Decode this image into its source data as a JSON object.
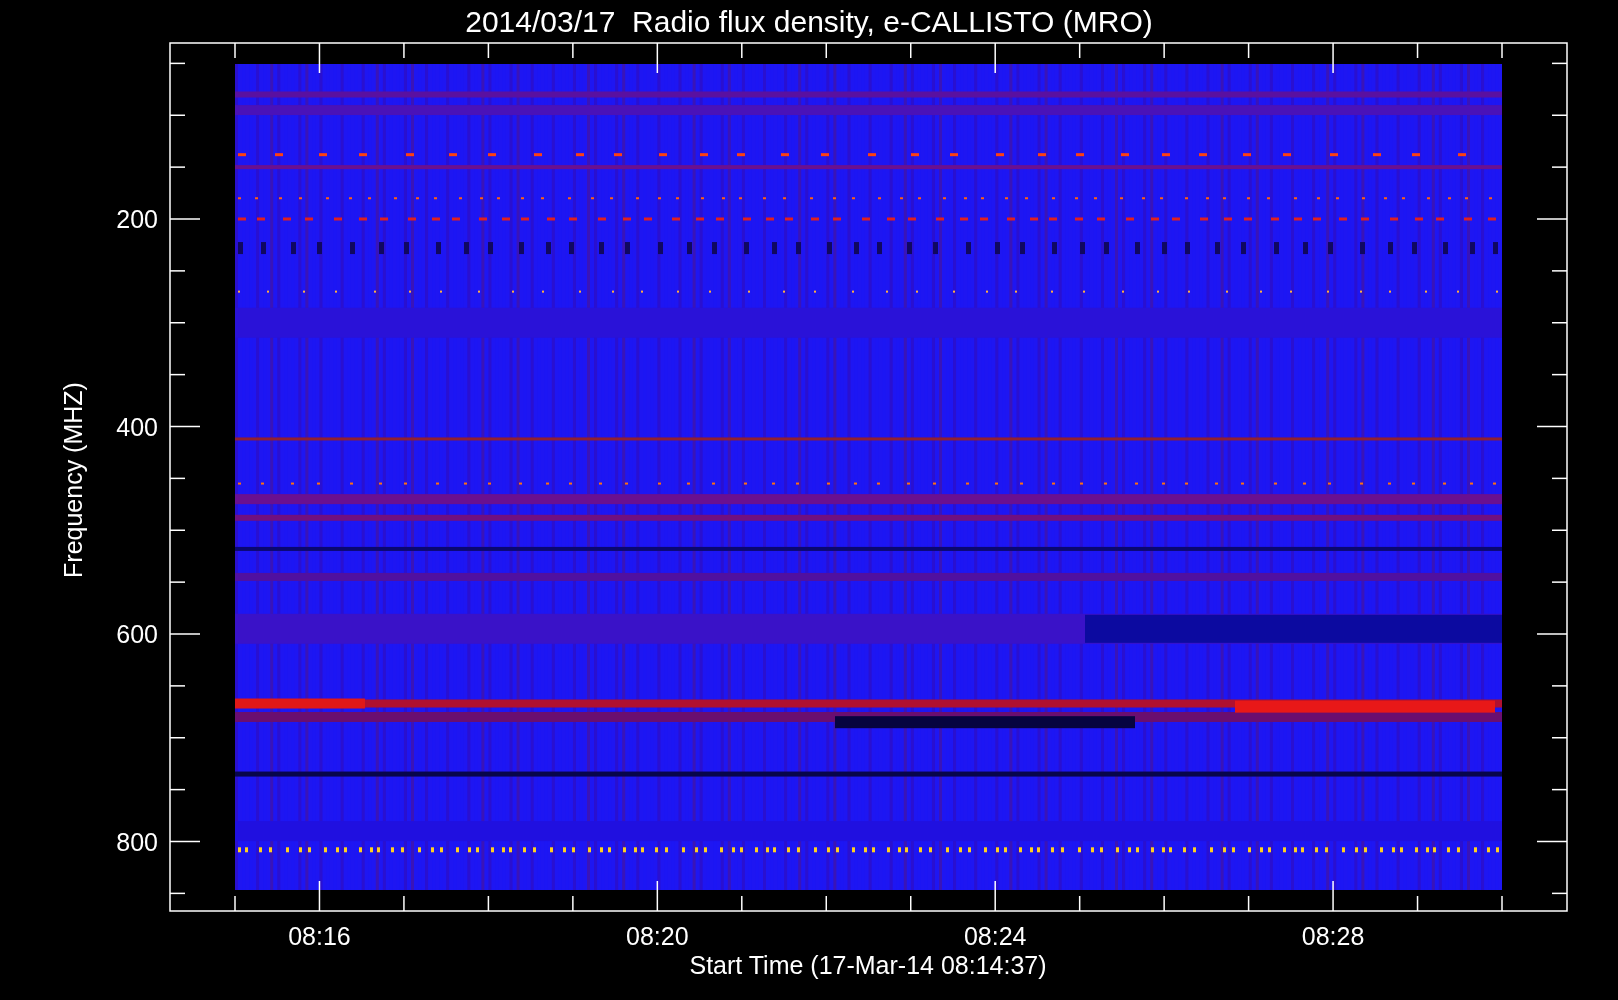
{
  "title": "2014/03/17  Radio flux density, e-CALLISTO (MRO)",
  "y_axis": {
    "label": "Frequency (MHZ)",
    "ticks": [
      "200",
      "400",
      "600",
      "800"
    ]
  },
  "x_axis": {
    "label": "Start Time (17-Mar-14 08:14:37)",
    "ticks": [
      "08:16",
      "08:20",
      "08:24",
      "08:28"
    ]
  }
}
